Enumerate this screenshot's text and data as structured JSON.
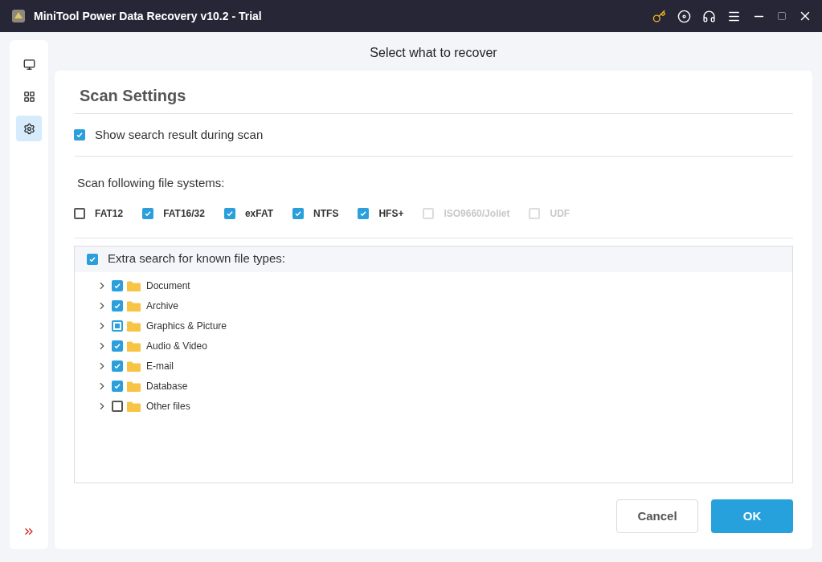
{
  "window": {
    "title": "MiniTool Power Data Recovery v10.2 - Trial"
  },
  "sidebar": {
    "items": [
      {
        "kind": "monitor",
        "selected": false
      },
      {
        "kind": "apps",
        "selected": false
      },
      {
        "kind": "settings",
        "selected": true
      }
    ]
  },
  "page_title": "Select what to recover",
  "panel": {
    "title": "Scan Settings",
    "show_results": {
      "label": "Show search result during scan",
      "checked": true
    },
    "fs_label": "Scan following file systems:",
    "file_systems": [
      {
        "label": "FAT12",
        "checked": false,
        "disabled": false
      },
      {
        "label": "FAT16/32",
        "checked": true,
        "disabled": false
      },
      {
        "label": "exFAT",
        "checked": true,
        "disabled": false
      },
      {
        "label": "NTFS",
        "checked": true,
        "disabled": false
      },
      {
        "label": "HFS+",
        "checked": true,
        "disabled": false
      },
      {
        "label": "ISO9660/Joliet",
        "checked": false,
        "disabled": true
      },
      {
        "label": "UDF",
        "checked": false,
        "disabled": true
      }
    ],
    "extra": {
      "label": "Extra search for known file types:",
      "checked": true
    },
    "file_types": [
      {
        "label": "Document",
        "checked": true,
        "partial": false,
        "expanded": false
      },
      {
        "label": "Archive",
        "checked": true,
        "partial": false,
        "expanded": false
      },
      {
        "label": "Graphics & Picture",
        "checked": false,
        "partial": true,
        "expanded": false
      },
      {
        "label": "Audio & Video",
        "checked": true,
        "partial": false,
        "expanded": false
      },
      {
        "label": "E-mail",
        "checked": true,
        "partial": false,
        "expanded": false
      },
      {
        "label": "Database",
        "checked": true,
        "partial": false,
        "expanded": false
      },
      {
        "label": "Other files",
        "checked": false,
        "partial": false,
        "expanded": false
      }
    ],
    "buttons": [
      {
        "label": "Cancel",
        "kind": "secondary"
      },
      {
        "label": "OK",
        "kind": "primary"
      }
    ]
  }
}
